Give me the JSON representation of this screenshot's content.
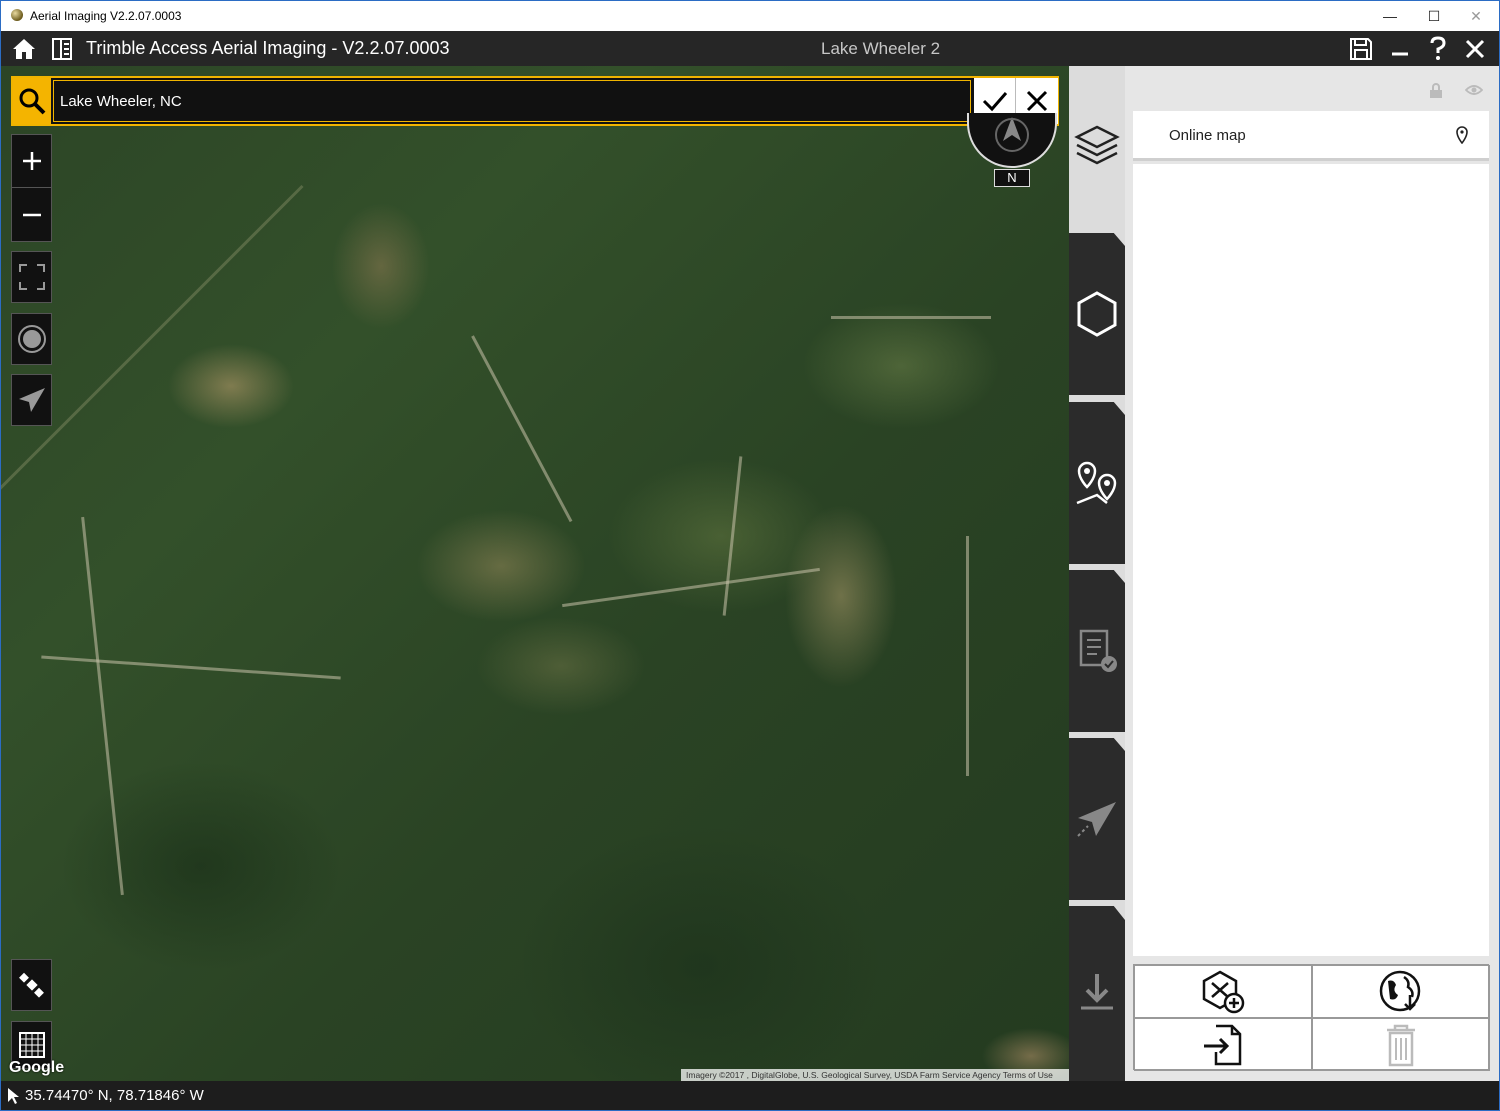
{
  "window": {
    "title": "Aerial Imaging V2.2.07.0003",
    "controls": {
      "minimize": "—",
      "maximize": "☐",
      "close": "✕"
    }
  },
  "header": {
    "title": "Trimble Access Aerial Imaging - V2.2.07.0003",
    "project": "Lake Wheeler 2"
  },
  "search": {
    "value": "Lake Wheeler, NC"
  },
  "compass": {
    "label": "N"
  },
  "map": {
    "provider": "Google",
    "attribution": "Imagery ©2017 , DigitalGlobe, U.S. Geological Survey, USDA Farm Service Agency    Terms of Use"
  },
  "panel": {
    "layers": [
      {
        "label": "Online map"
      }
    ]
  },
  "status": {
    "coordinates": "35.74470° N, 78.71846° W"
  },
  "colors": {
    "accent": "#f4b400",
    "header": "#262626",
    "panel": "#e6e6e6"
  }
}
